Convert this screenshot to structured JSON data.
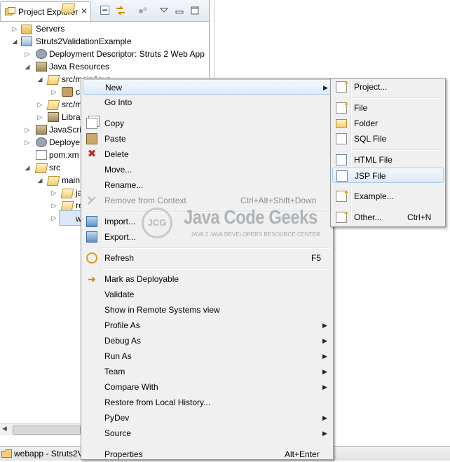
{
  "explorer": {
    "tab_title": "Project Explorer",
    "tab_close": "✕",
    "tree": [
      {
        "label": "Servers"
      },
      {
        "label": "Struts2ValidationExample"
      },
      {
        "label": "Deployment Descriptor: Struts 2 Web App"
      },
      {
        "label": "Java Resources"
      },
      {
        "label": "src/main/java"
      },
      {
        "label": "c"
      },
      {
        "label": "src/m"
      },
      {
        "label": "Libra"
      },
      {
        "label": "JavaScrip"
      },
      {
        "label": "Deploye"
      },
      {
        "label": "pom.xm"
      },
      {
        "label": "src"
      },
      {
        "label": "main"
      },
      {
        "label": "ja"
      },
      {
        "label": "re"
      },
      {
        "label": "w"
      }
    ]
  },
  "status_bar": {
    "text": "webapp - Struts2V"
  },
  "context_menu": {
    "items": [
      {
        "label": "New",
        "shortcut": "",
        "submenu": true
      },
      {
        "label": "Go Into"
      },
      {
        "label": "Copy"
      },
      {
        "label": "Paste"
      },
      {
        "label": "Delete"
      },
      {
        "label": "Move..."
      },
      {
        "label": "Rename..."
      },
      {
        "label": "Remove from Context",
        "shortcut": "Ctrl+Alt+Shift+Down",
        "disabled": true
      },
      {
        "label": "Import..."
      },
      {
        "label": "Export..."
      },
      {
        "label": "Refresh",
        "shortcut": "F5"
      },
      {
        "label": "Mark as Deployable"
      },
      {
        "label": "Validate"
      },
      {
        "label": "Show in Remote Systems view"
      },
      {
        "label": "Profile As",
        "submenu": true
      },
      {
        "label": "Debug As",
        "submenu": true
      },
      {
        "label": "Run As",
        "submenu": true
      },
      {
        "label": "Team",
        "submenu": true
      },
      {
        "label": "Compare With",
        "submenu": true
      },
      {
        "label": "Restore from Local History..."
      },
      {
        "label": "PyDev",
        "submenu": true
      },
      {
        "label": "Source",
        "submenu": true
      },
      {
        "label": "Properties",
        "shortcut": "Alt+Enter"
      }
    ]
  },
  "new_submenu": {
    "items": [
      {
        "label": "Project..."
      },
      {
        "label": "File"
      },
      {
        "label": "Folder"
      },
      {
        "label": "SQL File"
      },
      {
        "label": "HTML File"
      },
      {
        "label": "JSP File",
        "highlighted": true
      },
      {
        "label": "Example..."
      },
      {
        "label": "Other...",
        "shortcut": "Ctrl+N"
      }
    ]
  },
  "watermark": {
    "logo": "JCG",
    "title": "Java Code Geeks",
    "subtitle": "JAVA 2 JAVA DEVELOPERS RESOURCE CENTER"
  },
  "glyphs": {
    "submenu_arrow": "▶",
    "collapsed": "▷",
    "expanded": "◢",
    "h_scroll_left": "◀"
  },
  "icons": {
    "view": "project-explorer-icon",
    "close": "close-icon",
    "collapse_all": "collapse-all-icon",
    "link_editor": "link-with-editor-icon",
    "view_menu": "view-menu-icon",
    "minimize": "minimize-icon",
    "maximize": "maximize-icon"
  }
}
